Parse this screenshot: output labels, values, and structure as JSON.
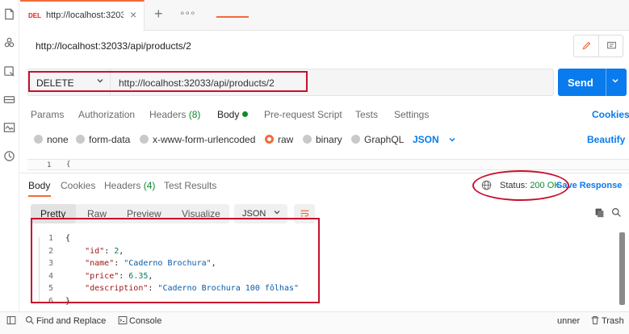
{
  "tab": {
    "method": "DEL",
    "title": "http://localhost:32033/api/products/2",
    "close": "×",
    "new_tab": "+",
    "more": "∘∘∘"
  },
  "request_name": "http://localhost:32033/api/products/2",
  "method": "DELETE",
  "url": "http://localhost:32033/api/products/2",
  "send_label": "Send",
  "request_tabs": [
    {
      "label": "Params"
    },
    {
      "label": "Authorization"
    },
    {
      "label": "Headers",
      "count": "(8)"
    },
    {
      "label": "Body"
    },
    {
      "label": "Pre-request Script"
    },
    {
      "label": "Tests"
    },
    {
      "label": "Settings"
    }
  ],
  "cookies_label": "Cookies",
  "body_types": [
    "none",
    "form-data",
    "x-www-form-urlencoded",
    "raw",
    "binary",
    "GraphQL"
  ],
  "body_format": "JSON",
  "beautify_label": "Beautify",
  "editor": {
    "line": "1",
    "text": "{"
  },
  "response_tabs": [
    {
      "label": "Body"
    },
    {
      "label": "Cookies"
    },
    {
      "label": "Headers",
      "count": "(4)"
    },
    {
      "label": "Test Results"
    }
  ],
  "status": {
    "label": "Status:",
    "value": "200 OK"
  },
  "save_response": "Save Response",
  "view_tabs": [
    "Pretty",
    "Raw",
    "Preview",
    "Visualize"
  ],
  "response_format": "JSON",
  "response_lines": [
    {
      "n": "1",
      "parts": [
        {
          "c": "",
          "t": "{"
        }
      ]
    },
    {
      "n": "2",
      "parts": [
        {
          "c": "",
          "t": "    "
        },
        {
          "c": "k",
          "t": "\"id\""
        },
        {
          "c": "",
          "t": ": "
        },
        {
          "c": "n",
          "t": "2"
        },
        {
          "c": "",
          "t": ","
        }
      ]
    },
    {
      "n": "3",
      "parts": [
        {
          "c": "",
          "t": "    "
        },
        {
          "c": "k",
          "t": "\"name\""
        },
        {
          "c": "",
          "t": ": "
        },
        {
          "c": "s",
          "t": "\"Caderno Brochura\""
        },
        {
          "c": "",
          "t": ","
        }
      ]
    },
    {
      "n": "4",
      "parts": [
        {
          "c": "",
          "t": "    "
        },
        {
          "c": "k",
          "t": "\"price\""
        },
        {
          "c": "",
          "t": ": "
        },
        {
          "c": "n",
          "t": "6.35"
        },
        {
          "c": "",
          "t": ","
        }
      ]
    },
    {
      "n": "5",
      "parts": [
        {
          "c": "",
          "t": "    "
        },
        {
          "c": "k",
          "t": "\"description\""
        },
        {
          "c": "",
          "t": ": "
        },
        {
          "c": "s",
          "t": "\"Caderno Brochura 100 fôlhas\""
        }
      ]
    },
    {
      "n": "6",
      "parts": [
        {
          "c": "",
          "t": "}"
        }
      ]
    }
  ],
  "footer": {
    "find_replace": "Find and Replace",
    "console": "Console",
    "runner": "unner",
    "trash": "Trash"
  },
  "icons": {
    "rail": [
      "page-icon",
      "apis-icon",
      "mock-icon",
      "environment-icon",
      "monitor-icon",
      "history-icon"
    ],
    "accent": "#f26b3a",
    "send_color": "#097bed",
    "status_color": "#0f8a2d",
    "annotation_color": "#c8102e"
  }
}
